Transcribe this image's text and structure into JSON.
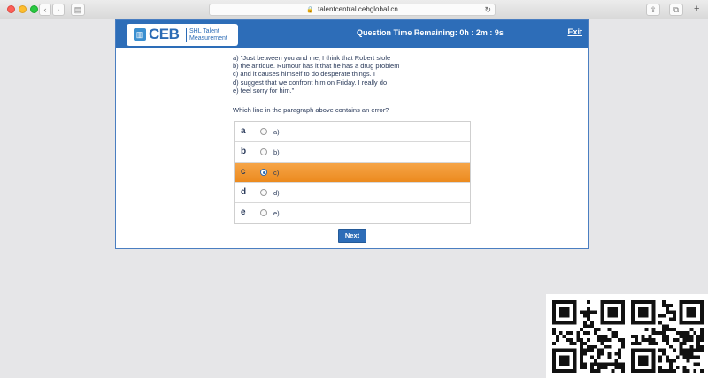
{
  "browser": {
    "url": "talentcentral.cebglobal.cn",
    "back_glyph": "‹",
    "forward_glyph": "›",
    "sidebar_glyph": "▤",
    "reload_glyph": "↻",
    "share_glyph": "⇪",
    "tabs_glyph": "⧉",
    "new_tab_glyph": "+",
    "lock_glyph": "🔒"
  },
  "header": {
    "logo_brand": "CEB",
    "logo_subtitle": "SHL Talent Measurement",
    "timer": "Question Time Remaining: 0h : 2m : 9s",
    "exit_label": "Exit"
  },
  "passage": {
    "lines": [
      "a) \"Just between you and me, I think that Robert stole",
      "b) the antique. Rumour has it that he has a drug problem",
      "c) and it causes himself to do desperate things. I",
      "d) suggest that we confront him on Friday. I really do",
      "e) feel sorry for him.\""
    ]
  },
  "question": "Which line in the paragraph above contains an error?",
  "options": [
    {
      "letter": "a",
      "label": "a)",
      "selected": false
    },
    {
      "letter": "b",
      "label": "b)",
      "selected": false
    },
    {
      "letter": "c",
      "label": "c)",
      "selected": true
    },
    {
      "letter": "d",
      "label": "d)",
      "selected": false
    },
    {
      "letter": "e",
      "label": "e)",
      "selected": false
    }
  ],
  "next_label": "Next",
  "colors": {
    "header_blue": "#2d6db8",
    "selected_orange": "#ec8a1e",
    "background": "#e6e6e8"
  }
}
